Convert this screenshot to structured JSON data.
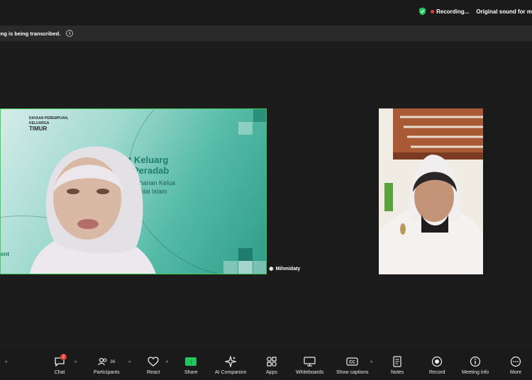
{
  "topbar": {
    "recording_label": "Recording...",
    "original_sound_label": "Original sound for m"
  },
  "transcription_banner": {
    "text": "eting is being transcribed."
  },
  "slide": {
    "org_line1": "DAYAAN PEREMPUAN,",
    "org_line2": "KELUARGA",
    "org_line3": "TIMUR",
    "title_line1": "t Keluarg",
    "title_line2": "Peradab",
    "sub_line1": "tahanan Kelua",
    "sub_line2": "i-Nilai Islam",
    "footer": "ent"
  },
  "participant_right": {
    "name": "Mihmidaty"
  },
  "toolbar": {
    "items": [
      {
        "label": "Chat",
        "badge": "2"
      },
      {
        "label": "Participants",
        "count": "36"
      },
      {
        "label": "React"
      },
      {
        "label": "Share"
      },
      {
        "label": "AI Companion"
      },
      {
        "label": "Apps"
      },
      {
        "label": "Whiteboards"
      },
      {
        "label": "Show captions"
      },
      {
        "label": "Notes"
      },
      {
        "label": "Record"
      },
      {
        "label": "Meeting info"
      },
      {
        "label": "More"
      }
    ]
  },
  "colors": {
    "active_speaker_border": "#3ecf5a",
    "recording_dot": "#e53935",
    "share_green": "#22c55e",
    "slide_teal": "#1f7d6d"
  }
}
